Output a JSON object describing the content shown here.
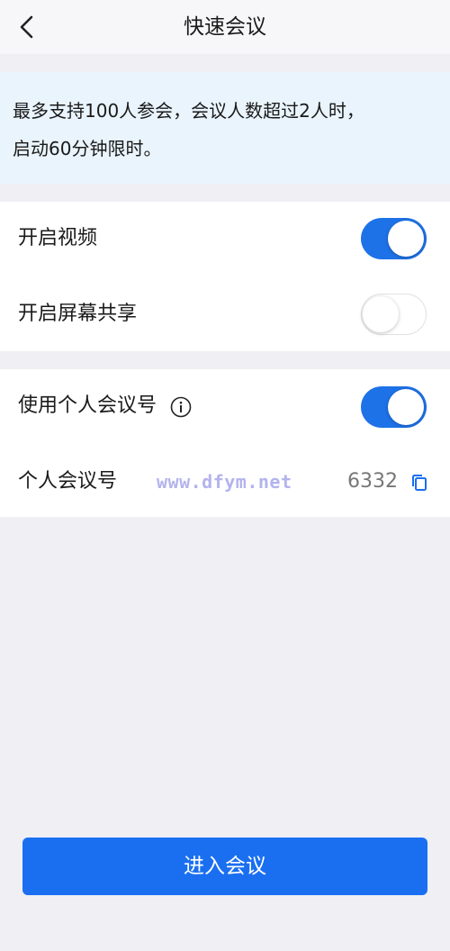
{
  "header": {
    "title": "快速会议"
  },
  "notice": {
    "line1": "最多支持100人参会，会议人数超过2人时，",
    "line2": "启动60分钟限时。"
  },
  "settings": {
    "video": {
      "label": "开启视频",
      "enabled": true
    },
    "screen_share": {
      "label": "开启屏幕共享",
      "enabled": false
    }
  },
  "personal": {
    "use_personal_id": {
      "label": "使用个人会议号",
      "enabled": true
    },
    "meeting_id": {
      "label": "个人会议号",
      "value": "6332"
    },
    "watermark": "www.dfym.net"
  },
  "actions": {
    "enter_label": "进入会议"
  },
  "colors": {
    "accent": "#1a6ff1",
    "toggle_on": "#1e72e8",
    "notice_bg": "#e9f4fc",
    "page_bg": "#efeff4"
  }
}
